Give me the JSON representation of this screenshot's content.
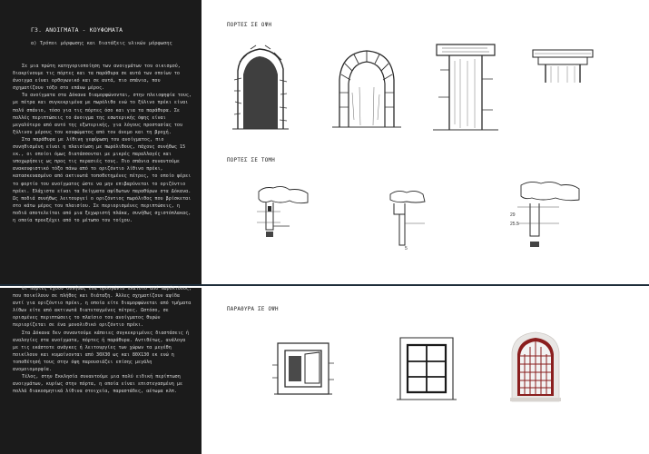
{
  "left_panel": {
    "title": "Γ3. ΑΝΟΙΓΜΑΤΑ - ΚΟΥΦΩΜΑΤΑ",
    "subtitle": "α) Τρόποι μόρφωσης και διατάξεις υλικών μόρφωσης",
    "top_paragraphs": [
      "Σε μια πρώτη κατηγοριοποίηση των ανοιγμάτων του οικισμού, διακρίνουμε τις πόρτες και τα παράθυρα σε αυτά των οποίων το άνοιγμα είναι ορθογωνικό και σε αυτά, πιο σπάνια, που σχηματίζουν τόξο στο επάνω μέρος.",
      "Τα ανοίγματα στα Δόκανα διαμορφώνονται, στην πλειοψηφία τους, με πέτρα και συγκεκριμένα με πωρόλιθο ενώ το ξύλινο πρέκι είναι πολύ σπάνιο, τόσο για τις πόρτες όσο και για τα παράθυρα. Σε πολλές περιπτώσεις το άνοιγμα της εσωτερικής όψης είναι μεγαλύτερο από αυτό της εξωτερικής, για λόγους προστασίας του ξύλινου μέρους του κουφώματος από τον άνεμο και τη βροχή.",
      "Στα παράθυρα με λίθινη γεφύρωση του ανοίγματος, πιο συνηθισμένη είναι η πλαισίωση με πωρόλιθους, πάχους συνήθως 15 εκ., οι οποίοι όμως διατάσσονται με μικρές παραλλαγές και υποχωρήσεις ως προς τις περασιές τους. Πιο σπάνια συναντούμε ανακουφιστικό τόξο πάνω από το οριζόντιο λίθινο πρέκι, κατασκευασμένο από ακτινωτά τοποθετημένες πέτρες, το οποίο φέρει το φορτίο του ανοίγματος ώστε να μην επιβαρύνεται το οριζόντιο πρέκι. Ελάχιστα είναι τα δείγματα αψίδωτων παραθύρων στα Δόκανα. Ως ποδιά συνήθως λειτουργεί ο οριζόντιος πωρόλιθος που βρίσκεται στο κάτω μέρος του πλαισίου. Σε περιορισμένες περιπτώσεις, η ποδιά αποτελείται από μια ξεχωριστή πλάκα, συνήθως σχιστόπλακας, η οποία προεξέχει από το μέτωπο του τοίχου."
    ],
    "bottom_paragraphs": [
      "Οι πόρτες έχουν συνήθως ένα ορθογώνιο πλαίσιο από πωρόλιθους, που ποικίλουν σε πλήθος και διάταξη. Άλλες σχηματίζουν αψίδα αντί για οριζόντιο πρέκι, η οποία είτε διαμορφώνεται από τμήματα λίθων είτε από ακτινωτά διατεταγμένες πέτρες. Ωστόσο, σε ορισμένες περιπτώσεις το πλαίσιο του ανοίγματος θυρών περιορίζεται σε ένα μονολιθικό οριζόντιο πρέκι.",
      "Στα Δόκανα δεν συναντούμε κάποιες συγκεκριμένες διαστάσεις ή αναλογίες στα ανοίγματα, πόρτες ή παράθυρα. Αντιθέτως, ανάλογα με τις εκάστοτε ανάγκες ή λειτουργίες των χώρων τα μεγέθη ποικίλουν και κυμαίνονται από 30Χ30 ως και 80Χ130 εκ ενώ η τοποθέτησή τους στην όψη παρουσιάζει επίσης μεγάλη ανομοιομορφία.",
      "Τέλος, στην Εκκλησία συναντούμε μια πολύ ειδική περίπτωση ανοιγμάτων, κυρίως στην πόρτα, η οποία είναι επιστεγασμένη με πολλά διακοσμητικά λίθινα στοιχεία, παραστάδες, αέτωμα κλπ."
    ]
  },
  "sections": {
    "doors_elevation": "ΠΟΡΤΕΣ ΣΕ ΟΨΗ",
    "doors_section": "ΠΟΡΤΕΣ ΣΕ ΤΟΜΗ",
    "windows_elevation": "ΠΑΡΑΘΥΡΑ ΣΕ ΟΨΗ"
  },
  "sketch_labels": {
    "dim_a": "29",
    "dim_b": "25.5",
    "dim_c": "5"
  },
  "colors": {
    "panel": "#1b1b1b",
    "divider": "#1e2d3a",
    "ink": "#2a2a2a"
  }
}
